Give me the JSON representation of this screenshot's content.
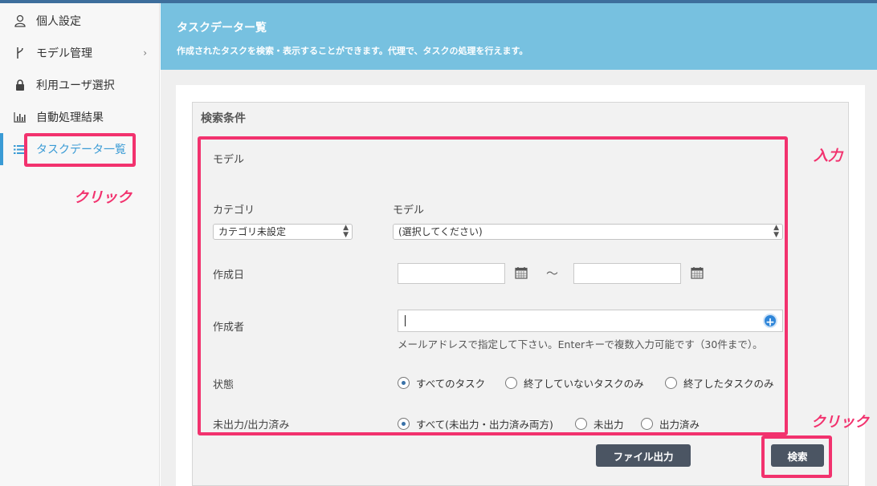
{
  "sidebar": {
    "items": [
      {
        "label": "個人設定",
        "icon": "user-icon"
      },
      {
        "label": "モデル管理",
        "icon": "branch-icon",
        "chevron": "›"
      },
      {
        "label": "利用ユーザ選択",
        "icon": "lock-icon"
      },
      {
        "label": "自動処理結果",
        "icon": "bar-chart-icon"
      },
      {
        "label": "タスクデータ一覧",
        "icon": "list-icon",
        "active": true
      }
    ]
  },
  "header": {
    "title": "タスクデーター覧",
    "subtitle": "作成されたタスクを検索・表示することができます。代理で、タスクの処理を行えます。"
  },
  "search": {
    "panel_title": "検索条件",
    "model_section_label": "モデル",
    "category_label": "カテゴリ",
    "category_value": "カテゴリ未設定",
    "model_label": "モデル",
    "model_value": "(選択してください)",
    "created_date_label": "作成日",
    "date_separator": "〜",
    "creator_label": "作成者",
    "creator_help": "メールアドレスで指定して下さい。Enterキーで複数入力可能です（30件まで）。",
    "status_label": "状態",
    "status_options": [
      "すべてのタスク",
      "終了していないタスクのみ",
      "終了したタスクのみ"
    ],
    "status_selected": 0,
    "output_label": "未出力/出力済み",
    "output_options": [
      "すべて(未出力・出力済み両方)",
      "未出力",
      "出力済み"
    ],
    "output_selected": 0,
    "file_output_button": "ファイル出力",
    "search_button": "検索"
  },
  "annotations": {
    "click_sidebar": "クリック",
    "input": "入力",
    "click_search": "クリック",
    "highlight_color": "#f2326e"
  },
  "colors": {
    "header_bg": "#77c1e0",
    "accent": "#3a9bd5",
    "button_bg": "#4b5563"
  }
}
